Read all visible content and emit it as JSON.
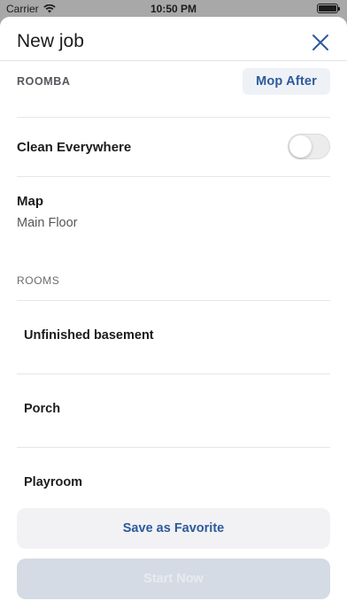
{
  "status_bar": {
    "carrier": "Carrier",
    "time": "10:50 PM"
  },
  "header": {
    "title": "New job"
  },
  "roomba": {
    "label": "ROOMBA",
    "mop_button": "Mop After"
  },
  "clean_everywhere": {
    "label": "Clean Everywhere",
    "enabled": false
  },
  "map": {
    "label": "Map",
    "value": "Main Floor"
  },
  "rooms": {
    "label": "ROOMS",
    "items": [
      {
        "name": "Unfinished basement"
      },
      {
        "name": "Porch"
      },
      {
        "name": "Playroom"
      }
    ]
  },
  "actions": {
    "favorite": "Save as Favorite",
    "start": "Start Now"
  },
  "colors": {
    "accent": "#2d5a9b",
    "disabled_button": "#d5dbe4",
    "secondary_button": "#f2f2f4"
  }
}
